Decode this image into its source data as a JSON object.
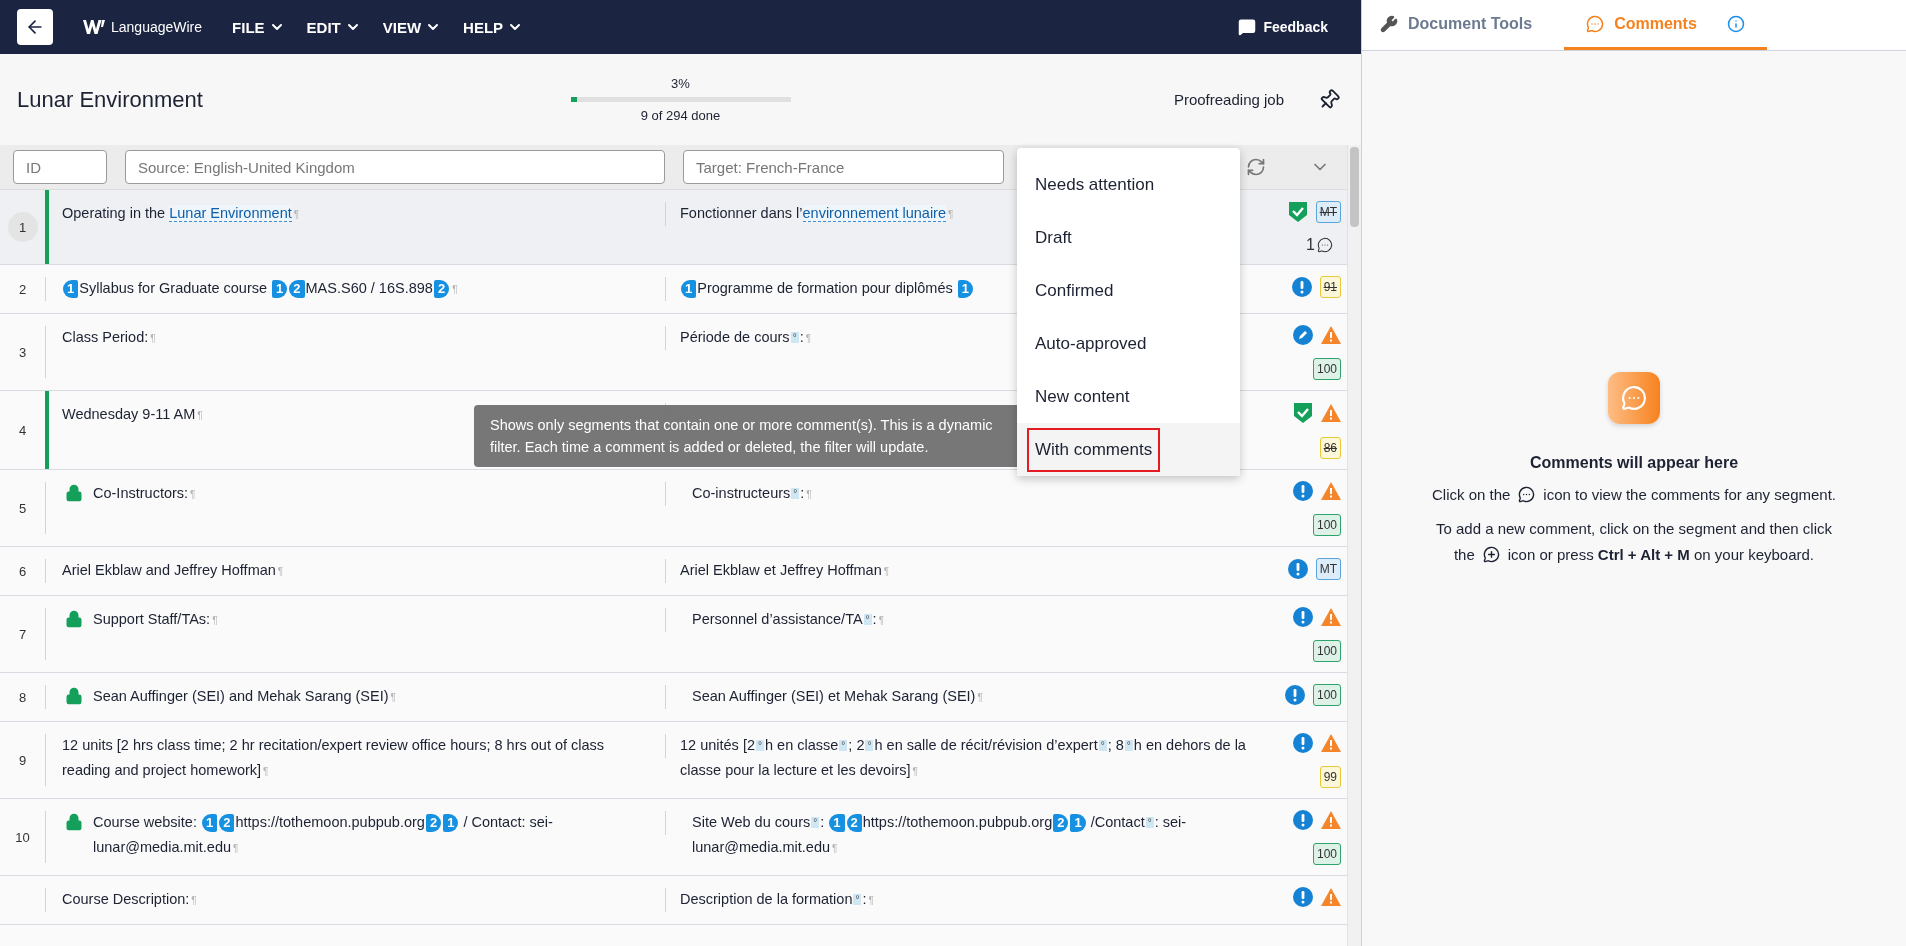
{
  "topbar": {
    "logo": "LanguageWire",
    "menus": [
      {
        "label": "FILE"
      },
      {
        "label": "EDIT"
      },
      {
        "label": "VIEW"
      },
      {
        "label": "HELP"
      }
    ],
    "feedback": "Feedback"
  },
  "header": {
    "title": "Lunar Environment",
    "progress": {
      "percent": "3%",
      "level": 0.03,
      "caption": "9 of 294 done"
    },
    "job": "Proofreading job"
  },
  "filters": {
    "id_placeholder": "ID",
    "source_placeholder": "Source: English-United Kingdom",
    "target_placeholder": "Target: French-France"
  },
  "status_menu": {
    "items": [
      {
        "label": "Needs attention",
        "selected": false
      },
      {
        "label": "Draft",
        "selected": false
      },
      {
        "label": "Confirmed",
        "selected": false
      },
      {
        "label": "Auto-approved",
        "selected": false
      },
      {
        "label": "New content",
        "selected": false
      },
      {
        "label": "With comments",
        "selected": true
      }
    ]
  },
  "tooltip": "Shows only segments that contain one or more comment(s). This is a dynamic filter. Each time a comment is added or deleted, the filter will update.",
  "segments": [
    {
      "number": "1",
      "selected": true,
      "confirmed": true,
      "locked": false,
      "kind": "confirmed",
      "warning": false,
      "match": {
        "text": "MT",
        "kind": "mt",
        "struck": true
      },
      "comments": "1",
      "source": [
        {
          "kind": "text",
          "text": "Operating in the "
        },
        {
          "kind": "term",
          "text": "Lunar Environment"
        },
        {
          "kind": "pilcrow",
          "text": "¶"
        }
      ],
      "target": [
        {
          "kind": "text",
          "text": "Fonctionner dans l’"
        },
        {
          "kind": "term",
          "text": "environnement lunaire"
        },
        {
          "kind": "pilcrow",
          "text": "¶"
        }
      ]
    },
    {
      "number": "2",
      "selected": false,
      "confirmed": false,
      "locked": false,
      "kind": "attention",
      "warning": false,
      "match": {
        "text": "91",
        "kind": "fuzzy",
        "struck": true
      },
      "source": [
        {
          "kind": "open",
          "text": "1"
        },
        {
          "kind": "text",
          "text": "Syllabus for Graduate course "
        },
        {
          "kind": "close",
          "text": "1"
        },
        {
          "kind": "open",
          "text": "2"
        },
        {
          "kind": "text",
          "text": "MAS.S60 / 16S.898"
        },
        {
          "kind": "close",
          "text": "2"
        },
        {
          "kind": "pilcrow",
          "text": "¶"
        }
      ],
      "target": [
        {
          "kind": "open",
          "text": "1"
        },
        {
          "kind": "text",
          "text": "Programme de formation pour diplômés "
        },
        {
          "kind": "close",
          "text": "1"
        }
      ]
    },
    {
      "number": "3",
      "selected": false,
      "confirmed": false,
      "locked": false,
      "kind": "draft",
      "warning": true,
      "match": {
        "text": "100",
        "kind": "exact",
        "struck": false
      },
      "source": [
        {
          "kind": "text",
          "text": "Class Period:"
        },
        {
          "kind": "pilcrow",
          "text": "¶"
        }
      ],
      "target": [
        {
          "kind": "text",
          "text": "Période de cours"
        },
        {
          "kind": "space",
          "text": "°"
        },
        {
          "kind": "text",
          "text": ":"
        },
        {
          "kind": "pilcrow",
          "text": "¶"
        }
      ]
    },
    {
      "number": "4",
      "selected": false,
      "confirmed": true,
      "locked": false,
      "kind": "confirmed",
      "warning": true,
      "match": {
        "text": "86",
        "kind": "fuzzy",
        "struck": true
      },
      "source": [
        {
          "kind": "text",
          "text": "Wednesday 9-11 AM"
        },
        {
          "kind": "pilcrow",
          "text": "¶"
        }
      ]
    },
    {
      "number": "5",
      "selected": false,
      "confirmed": false,
      "locked": true,
      "kind": "attention",
      "warning": true,
      "match": {
        "text": "100",
        "kind": "exact",
        "struck": false
      },
      "source": [
        {
          "kind": "text",
          "text": "Co-Instructors:"
        },
        {
          "kind": "pilcrow",
          "text": "¶"
        }
      ],
      "target": [
        {
          "kind": "text",
          "text": "Co-instructeurs"
        },
        {
          "kind": "space",
          "text": "°"
        },
        {
          "kind": "text",
          "text": ":"
        },
        {
          "kind": "pilcrow",
          "text": "¶"
        }
      ]
    },
    {
      "number": "6",
      "selected": false,
      "confirmed": false,
      "locked": false,
      "kind": "attention",
      "warning": false,
      "match": {
        "text": "MT",
        "kind": "mt",
        "struck": false
      },
      "source": [
        {
          "kind": "text",
          "text": "Ariel Ekblaw and Jeffrey Hoffman"
        },
        {
          "kind": "pilcrow",
          "text": "¶"
        }
      ],
      "target": [
        {
          "kind": "text",
          "text": "Ariel Ekblaw et Jeffrey Hoffman"
        },
        {
          "kind": "pilcrow",
          "text": "¶"
        }
      ]
    },
    {
      "number": "7",
      "selected": false,
      "confirmed": false,
      "locked": true,
      "kind": "attention",
      "warning": true,
      "match": {
        "text": "100",
        "kind": "exact",
        "struck": false
      },
      "source": [
        {
          "kind": "text",
          "text": "Support Staff/TAs:"
        },
        {
          "kind": "pilcrow",
          "text": "¶"
        }
      ],
      "target": [
        {
          "kind": "text",
          "text": "Personnel d’assistance/TA"
        },
        {
          "kind": "space",
          "text": "°"
        },
        {
          "kind": "text",
          "text": ":"
        },
        {
          "kind": "pilcrow",
          "text": "¶"
        }
      ]
    },
    {
      "number": "8",
      "selected": false,
      "confirmed": false,
      "locked": true,
      "kind": "attention",
      "warning": false,
      "match": {
        "text": "100",
        "kind": "exact",
        "struck": false
      },
      "source": [
        {
          "kind": "text",
          "text": "Sean Auffinger (SEI) and Mehak Sarang (SEI)"
        },
        {
          "kind": "pilcrow",
          "text": "¶"
        }
      ],
      "target": [
        {
          "kind": "text",
          "text": "Sean Auffinger (SEI) et Mehak Sarang (SEI)"
        },
        {
          "kind": "pilcrow",
          "text": "¶"
        }
      ]
    },
    {
      "number": "9",
      "selected": false,
      "confirmed": false,
      "locked": false,
      "kind": "attention",
      "warning": true,
      "match": {
        "text": "99",
        "kind": "fuzzy",
        "struck": false
      },
      "source": [
        {
          "kind": "text",
          "text": "12 units [2 hrs class time; 2 hr recitation/expert review office hours; 8 hrs out of class reading and project homework]"
        },
        {
          "kind": "pilcrow",
          "text": "¶"
        }
      ],
      "target": [
        {
          "kind": "text",
          "text": "12 unités [2"
        },
        {
          "kind": "space",
          "text": "°"
        },
        {
          "kind": "text",
          "text": "h en classe"
        },
        {
          "kind": "space",
          "text": "°"
        },
        {
          "kind": "text",
          "text": "; 2"
        },
        {
          "kind": "space",
          "text": "°"
        },
        {
          "kind": "text",
          "text": "h en salle de récit/révision d’expert"
        },
        {
          "kind": "space",
          "text": "°"
        },
        {
          "kind": "text",
          "text": "; 8"
        },
        {
          "kind": "space",
          "text": "°"
        },
        {
          "kind": "text",
          "text": "h en dehors de la classe pour la lecture et les devoirs]"
        },
        {
          "kind": "pilcrow",
          "text": "¶"
        }
      ]
    },
    {
      "number": "10",
      "selected": false,
      "confirmed": false,
      "locked": true,
      "kind": "attention",
      "warning": true,
      "match": {
        "text": "100",
        "kind": "exact",
        "struck": false
      },
      "source": [
        {
          "kind": "text",
          "text": "Course website: "
        },
        {
          "kind": "open",
          "text": "1"
        },
        {
          "kind": "open",
          "text": "2"
        },
        {
          "kind": "text",
          "text": "https://tothemoon.pubpub.org"
        },
        {
          "kind": "close",
          "text": "2"
        },
        {
          "kind": "close",
          "text": "1"
        },
        {
          "kind": "text",
          "text": " / Contact: sei-lunar@media.mit.edu"
        },
        {
          "kind": "pilcrow",
          "text": "¶"
        }
      ],
      "target": [
        {
          "kind": "text",
          "text": "Site Web du cours"
        },
        {
          "kind": "space",
          "text": "°"
        },
        {
          "kind": "text",
          "text": ": "
        },
        {
          "kind": "open",
          "text": "1"
        },
        {
          "kind": "open",
          "text": "2"
        },
        {
          "kind": "text",
          "text": "https://tothemoon.pubpub.org"
        },
        {
          "kind": "close",
          "text": "2"
        },
        {
          "kind": "close",
          "text": "1"
        },
        {
          "kind": "text",
          "text": " /Contact"
        },
        {
          "kind": "space",
          "text": "°"
        },
        {
          "kind": "text",
          "text": ": sei-lunar@media.mit.edu"
        },
        {
          "kind": "pilcrow",
          "text": "¶"
        }
      ]
    },
    {
      "selected": false,
      "confirmed": false,
      "locked": false,
      "kind": "attention",
      "warning": true,
      "source": [
        {
          "kind": "text",
          "text": "Course Description:"
        },
        {
          "kind": "pilcrow",
          "text": "¶"
        }
      ],
      "target": [
        {
          "kind": "text",
          "text": "Description de la formation"
        },
        {
          "kind": "space",
          "text": "°"
        },
        {
          "kind": "text",
          "text": ":"
        },
        {
          "kind": "pilcrow",
          "text": "¶"
        }
      ]
    }
  ],
  "side_panel": {
    "tabs": [
      {
        "label": "Document Tools",
        "kind": "tools",
        "selected": false
      },
      {
        "label": "Comments",
        "kind": "comments",
        "selected": true
      }
    ],
    "empty": {
      "title": "Comments will appear here",
      "line_1_before": "Click on the",
      "line_1_after": "icon to view the comments for any segment.",
      "line_2": "To add a new comment, click on the segment and then click",
      "line_3_before": "the",
      "line_3_after": "icon or press **Ctrl + Alt + M** on your keyboard."
    }
  }
}
